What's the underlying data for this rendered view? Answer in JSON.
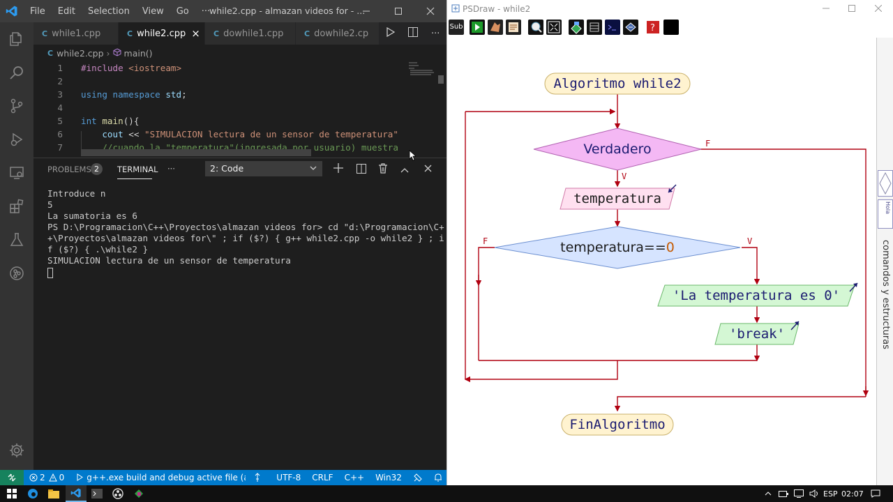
{
  "vscode": {
    "menu": [
      "File",
      "Edit",
      "Selection",
      "View",
      "Go"
    ],
    "menu_more": "···",
    "window_title": "while2.cpp - almazan videos for - ...",
    "tabs": [
      {
        "label": "while1.cpp",
        "icon": "cpp-file-icon",
        "active": false
      },
      {
        "label": "while2.cpp",
        "icon": "cpp-file-icon",
        "active": true
      },
      {
        "label": "dowhile1.cpp",
        "icon": "cpp-file-icon",
        "active": false
      },
      {
        "label": "dowhile2.cp",
        "icon": "cpp-file-icon",
        "active": false
      }
    ],
    "tab_close": "×",
    "breadcrumb": {
      "file": "while2.cpp",
      "symbol": "main()"
    },
    "code_lines": [
      {
        "n": "1",
        "parts": [
          [
            "pp",
            "#include "
          ],
          [
            "str",
            "<iostream>"
          ]
        ]
      },
      {
        "n": "2",
        "parts": []
      },
      {
        "n": "3",
        "parts": [
          [
            "kw",
            "using "
          ],
          [
            "kw",
            "namespace "
          ],
          [
            "id",
            "std"
          ],
          [
            "df",
            ";"
          ]
        ]
      },
      {
        "n": "4",
        "parts": []
      },
      {
        "n": "5",
        "parts": [
          [
            "kw",
            "int "
          ],
          [
            "fn",
            "main"
          ],
          [
            "df",
            "(){"
          ]
        ]
      },
      {
        "n": "6",
        "parts": [
          [
            "df",
            "    "
          ],
          [
            "id",
            "cout"
          ],
          [
            "df",
            " << "
          ],
          [
            "str",
            "\"SIMULACION lectura de un sensor de temperatura\""
          ]
        ]
      },
      {
        "n": "7",
        "parts": [
          [
            "df",
            "    "
          ],
          [
            "com",
            "//cuando la \"temperatura\"(ingresada por usuario) muestra"
          ]
        ]
      }
    ],
    "panel": {
      "problems_label": "PROBLEMS",
      "problems_count": "2",
      "terminal_label": "TERMINAL",
      "more": "···",
      "terminal_select": "2: Code"
    },
    "terminal_lines": [
      "Introduce n",
      "5",
      "La sumatoria es 6",
      "PS D:\\Programacion\\C++\\Proyectos\\almazan videos for> cd \"d:\\Programacion\\C+",
      "+\\Proyectos\\almazan videos for\\\" ; if ($?) { g++ while2.cpp -o while2 } ; i",
      "f ($?) { .\\while2 }",
      "SIMULACION lectura de un sensor de temperatura"
    ],
    "status": {
      "errors": "2",
      "warnings": "0",
      "build": "g++.exe build and debug active file (almaz",
      "encoding": "UTF-8",
      "eol": "CRLF",
      "language": "C++",
      "platform": "Win32"
    }
  },
  "psdraw": {
    "title": "PSDraw - while2",
    "side_label": "comandos y estructuras",
    "side_items": [
      "Hola",
      "Hola"
    ],
    "flow": {
      "start": "Algoritmo while2",
      "while_cond": "Verdadero",
      "read": "temperatura",
      "if_cond_var": "temperatura==",
      "if_cond_val": "0",
      "out1": "'La temperatura es 0'",
      "out2": "'break'",
      "end": "FinAlgoritmo",
      "false_label": "F",
      "true_label": "V"
    }
  },
  "taskbar": {
    "lang": "ESP",
    "time": "02:07"
  },
  "colors": {
    "vscode_blue": "#007acc",
    "flow_line": "#b00010",
    "terminal_fill": "#ffe0f0",
    "decision_fill": "#f4b8f4",
    "if_fill": "#d6e4ff",
    "output_fill": "#d4f7d4",
    "start_fill": "#fff3d0"
  }
}
